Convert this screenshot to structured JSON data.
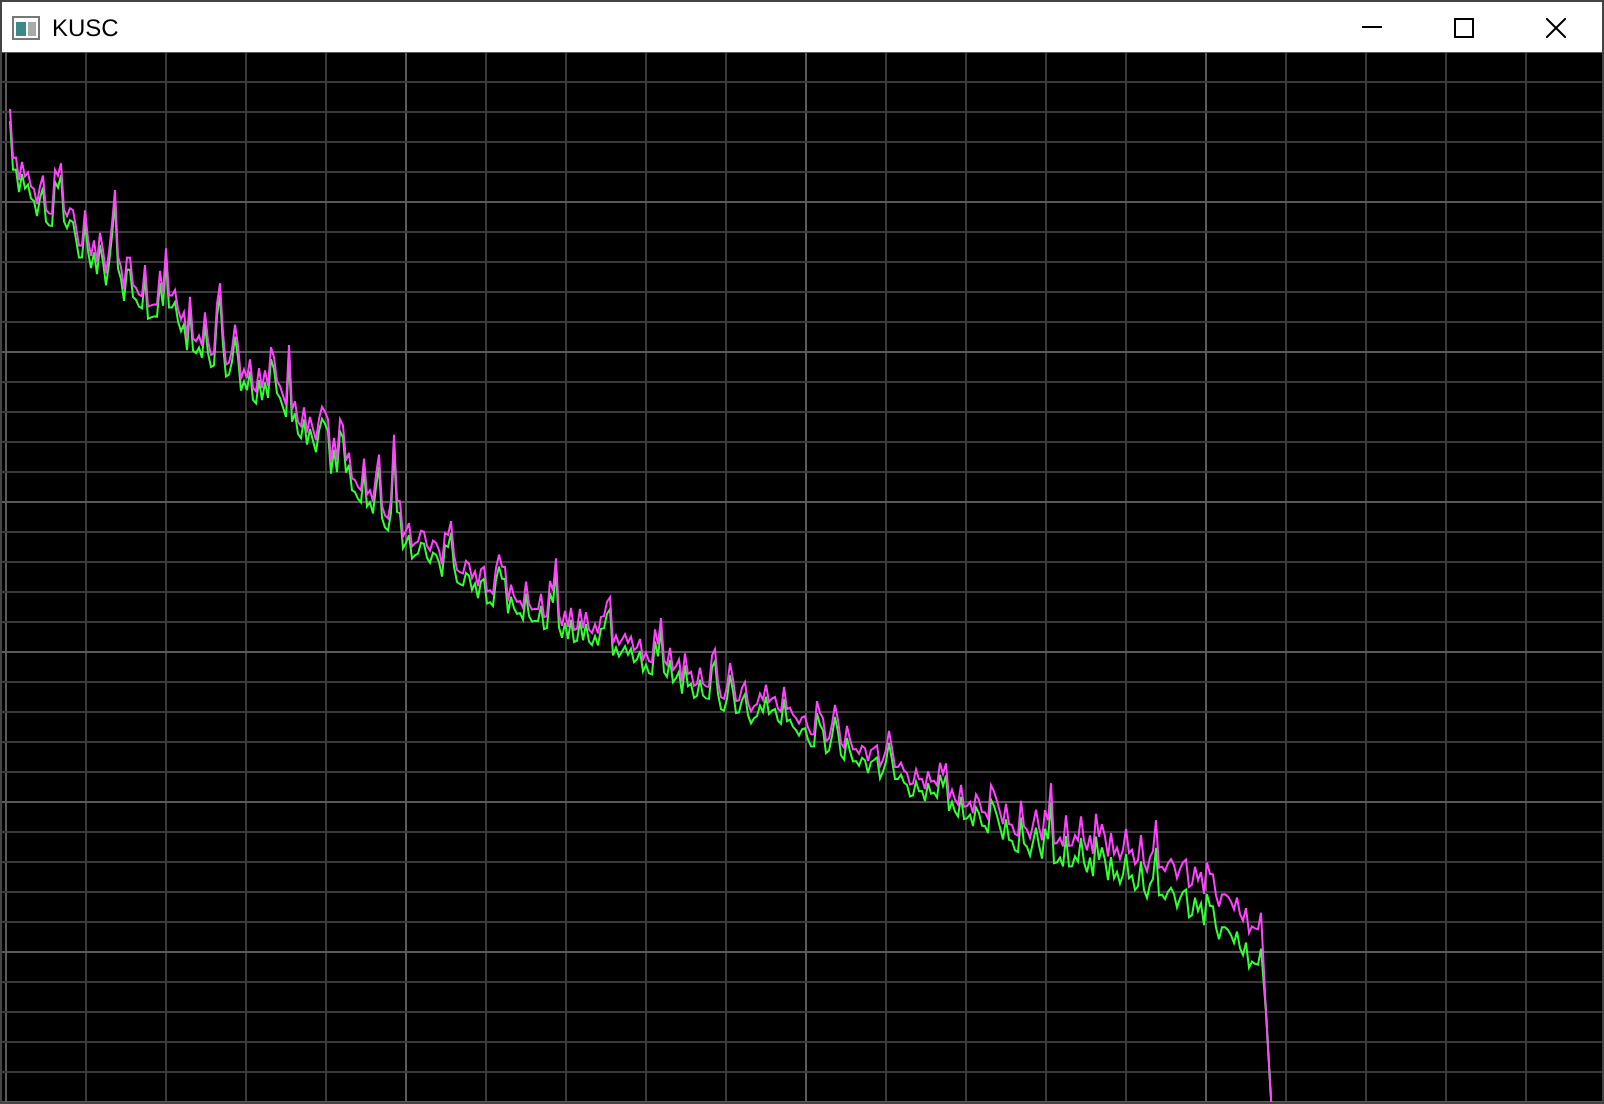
{
  "window": {
    "title": "KUSC"
  }
}
